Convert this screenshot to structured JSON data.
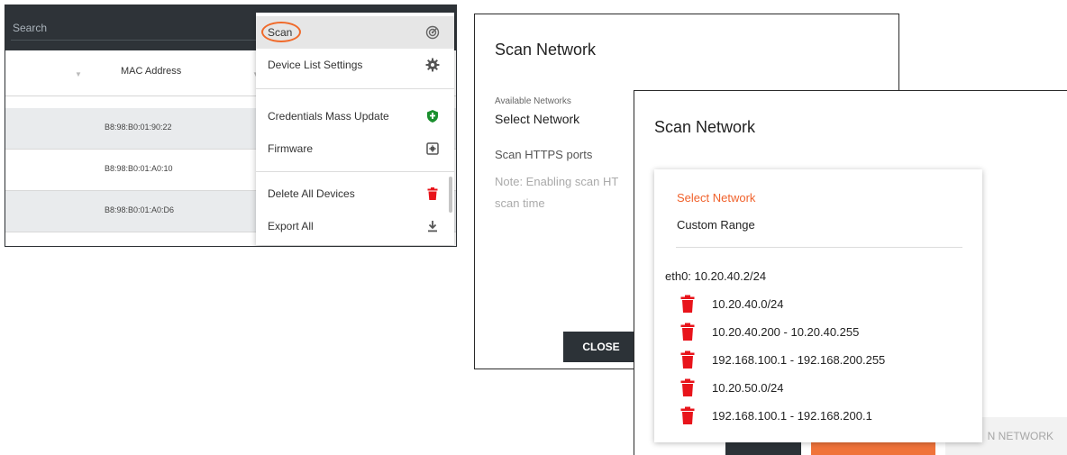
{
  "panel1": {
    "search_placeholder": "Search",
    "column_mac": "MAC Address",
    "rows": [
      "B8:98:B0:01:90:22",
      "B8:98:B0:01:A0:10",
      "B8:98:B0:01:A0:D6"
    ],
    "menu": [
      {
        "label": "Scan",
        "icon": "radar-icon",
        "active": true
      },
      {
        "label": "Device List Settings",
        "icon": "gear-icon"
      },
      {
        "label": "Credentials Mass Update",
        "icon": "shield-icon"
      },
      {
        "label": "Firmware",
        "icon": "chip-icon"
      },
      {
        "label": "Delete All Devices",
        "icon": "trash-icon"
      },
      {
        "label": "Export All",
        "icon": "download-icon"
      }
    ]
  },
  "scan_dialog_back": {
    "title": "Scan Network",
    "available_label": "Available Networks",
    "select_value": "Select Network",
    "https_label": "Scan HTTPS ports",
    "note_line1": "Note: Enabling scan HT",
    "note_line2": "scan time",
    "close_button": "CLOSE"
  },
  "scan_dialog_front": {
    "title": "Scan Network",
    "dropdown": {
      "select_option": "Select Network",
      "custom_range": "Custom Range",
      "interface": "eth0: 10.20.40.2/24",
      "ranges": [
        "10.20.40.0/24",
        "10.20.40.200 - 10.20.40.255",
        "192.168.100.1 - 192.168.200.255",
        "10.20.50.0/24",
        "192.168.100.1 - 192.168.200.1"
      ]
    },
    "scan_button_partial": "N NETWORK"
  },
  "colors": {
    "accent_orange": "#f06a2a",
    "trash_red": "#e8141b",
    "shield_green": "#1a8f2e",
    "dark_bar": "#2e3338"
  }
}
